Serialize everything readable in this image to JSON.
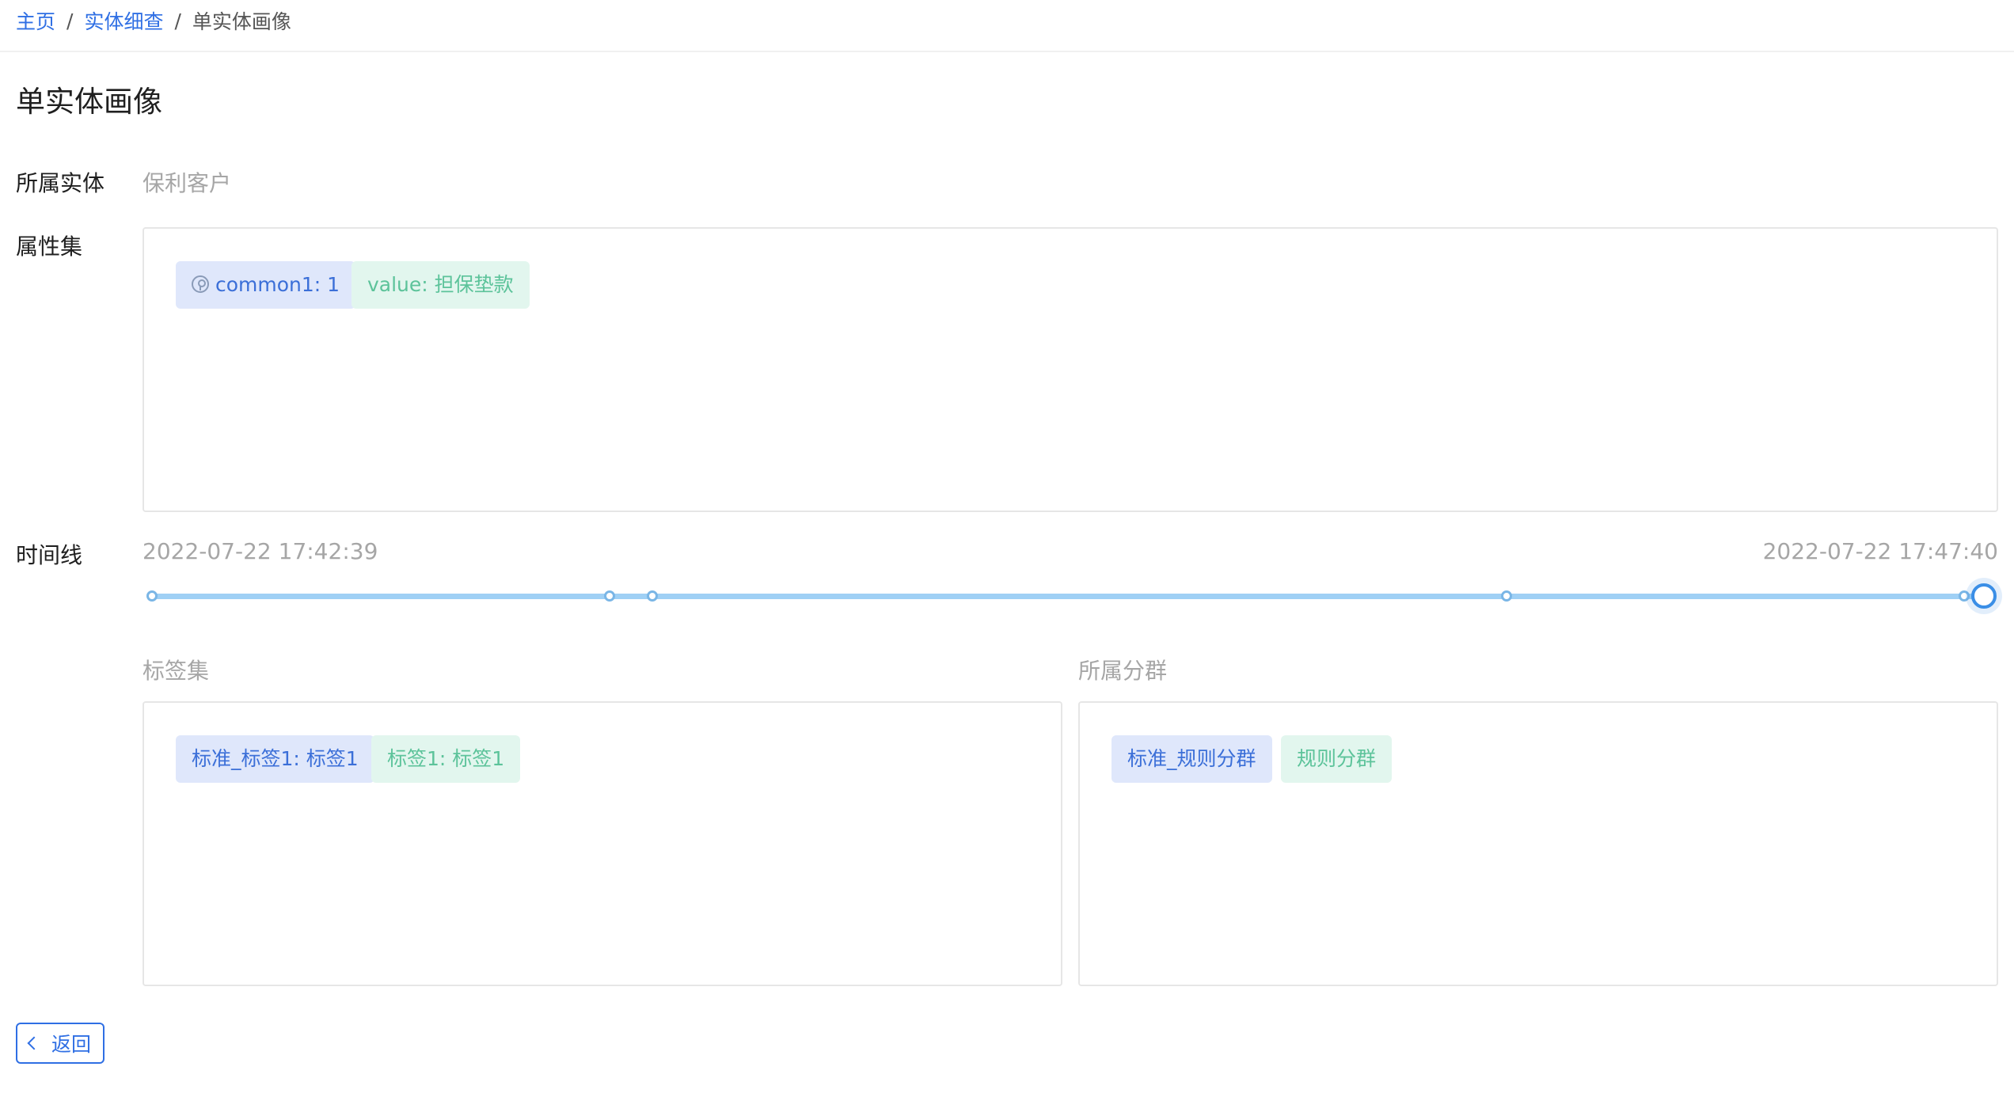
{
  "breadcrumb": {
    "items": [
      "主页",
      "实体细查"
    ],
    "current": "单实体画像",
    "separator": "/"
  },
  "page_title": "单实体画像",
  "entity": {
    "label": "所属实体",
    "value": "保利客户"
  },
  "attributes": {
    "label": "属性集",
    "tags": [
      {
        "text": "common1: 1",
        "color": "blue",
        "icon": "key-icon"
      },
      {
        "text": "value: 担保垫款",
        "color": "green"
      }
    ]
  },
  "timeline": {
    "label": "时间线",
    "start": "2022-07-22 17:42:39",
    "end": "2022-07-22 17:47:40"
  },
  "tag_set": {
    "title": "标签集",
    "tags": [
      {
        "text": "标准_标签1: 标签1",
        "color": "blue"
      },
      {
        "text": "标签1: 标签1",
        "color": "green"
      }
    ]
  },
  "groups": {
    "title": "所属分群",
    "tags": [
      {
        "text": "标准_规则分群",
        "color": "blue"
      },
      {
        "text": "规则分群",
        "color": "green"
      }
    ]
  },
  "back_button": {
    "label": "返回",
    "icon": "chevron-left-icon"
  },
  "colors": {
    "link": "#2f6fe4",
    "tag_blue_bg": "#dfe7fb",
    "tag_blue_text": "#3b6fd8",
    "tag_green_bg": "#e2f6ee",
    "tag_green_text": "#5cc39a",
    "timeline_track": "#9fd0f5",
    "timeline_handle": "#3a8ee6"
  }
}
